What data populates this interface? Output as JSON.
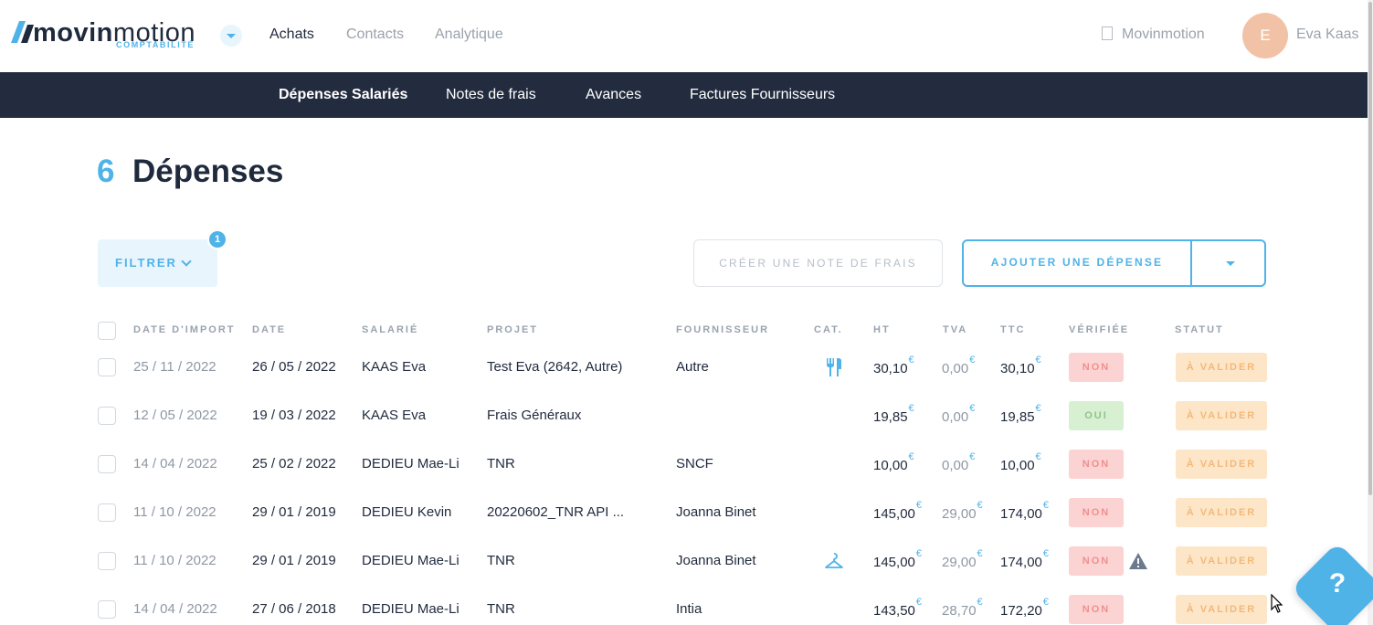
{
  "brand": {
    "logo_bold": "movin",
    "logo_light": "motion",
    "logo_sub": "COMPTABILITÉ"
  },
  "top_nav": {
    "items": [
      {
        "label": "Achats",
        "active": true
      },
      {
        "label": "Contacts",
        "active": false
      },
      {
        "label": "Analytique",
        "active": false
      }
    ],
    "company": "Movinmotion",
    "avatar_initial": "E",
    "user_name": "Eva Kaas"
  },
  "sub_nav": {
    "items": [
      {
        "label": "Dépenses Salariés",
        "active": true
      },
      {
        "label": "Notes de frais",
        "active": false
      },
      {
        "label": "Avances",
        "active": false
      },
      {
        "label": "Factures Fournisseurs",
        "active": false
      }
    ]
  },
  "page": {
    "count": "6",
    "title": "Dépenses"
  },
  "toolbar": {
    "filter_label": "FILTRER",
    "filter_badge": "1",
    "create_note_label": "CRÉER UNE NOTE DE FRAIS",
    "add_expense_label": "AJOUTER UNE DÉPENSE"
  },
  "table": {
    "headers": {
      "import_date": "DATE D'IMPORT",
      "date": "DATE",
      "employee": "SALARIÉ",
      "project": "PROJET",
      "supplier": "FOURNISSEUR",
      "category": "CAT.",
      "ht": "HT",
      "tva": "TVA",
      "ttc": "TTC",
      "verified": "VÉRIFIÉE",
      "status": "STATUT"
    },
    "currency": "€",
    "rows": [
      {
        "import_date": "25 / 11 / 2022",
        "date": "26 / 05 / 2022",
        "employee": "KAAS Eva",
        "project": "Test Eva (2642, Autre)",
        "supplier": "Autre",
        "category_icon": "fork-knife-icon",
        "ht": "30,10",
        "tva": "0,00",
        "ttc": "30,10",
        "verified": "NON",
        "warning": false,
        "status": "À VALIDER"
      },
      {
        "import_date": "12 / 05 / 2022",
        "date": "19 / 03 / 2022",
        "employee": "KAAS Eva",
        "project": "Frais Généraux",
        "supplier": "",
        "category_icon": "",
        "ht": "19,85",
        "tva": "0,00",
        "ttc": "19,85",
        "verified": "OUI",
        "warning": false,
        "status": "À VALIDER"
      },
      {
        "import_date": "14 / 04 / 2022",
        "date": "25 / 02 / 2022",
        "employee": "DEDIEU Mae-Li",
        "project": "TNR",
        "supplier": "SNCF",
        "category_icon": "",
        "ht": "10,00",
        "tva": "0,00",
        "ttc": "10,00",
        "verified": "NON",
        "warning": false,
        "status": "À VALIDER"
      },
      {
        "import_date": "11 / 10 / 2022",
        "date": "29 / 01 / 2019",
        "employee": "DEDIEU Kevin",
        "project": "20220602_TNR API ...",
        "supplier": "Joanna Binet",
        "category_icon": "",
        "ht": "145,00",
        "tva": "29,00",
        "ttc": "174,00",
        "verified": "NON",
        "warning": false,
        "status": "À VALIDER"
      },
      {
        "import_date": "11 / 10 / 2022",
        "date": "29 / 01 / 2019",
        "employee": "DEDIEU Mae-Li",
        "project": "TNR",
        "supplier": "Joanna Binet",
        "category_icon": "hanger-icon",
        "ht": "145,00",
        "tva": "29,00",
        "ttc": "174,00",
        "verified": "NON",
        "warning": true,
        "status": "À VALIDER"
      },
      {
        "import_date": "14 / 04 / 2022",
        "date": "27 / 06 / 2018",
        "employee": "DEDIEU Mae-Li",
        "project": "TNR",
        "supplier": "Intia",
        "category_icon": "",
        "ht": "143,50",
        "tva": "28,70",
        "ttc": "172,20",
        "verified": "NON",
        "warning": false,
        "status": "À VALIDER"
      }
    ]
  },
  "help": {
    "label": "?"
  }
}
